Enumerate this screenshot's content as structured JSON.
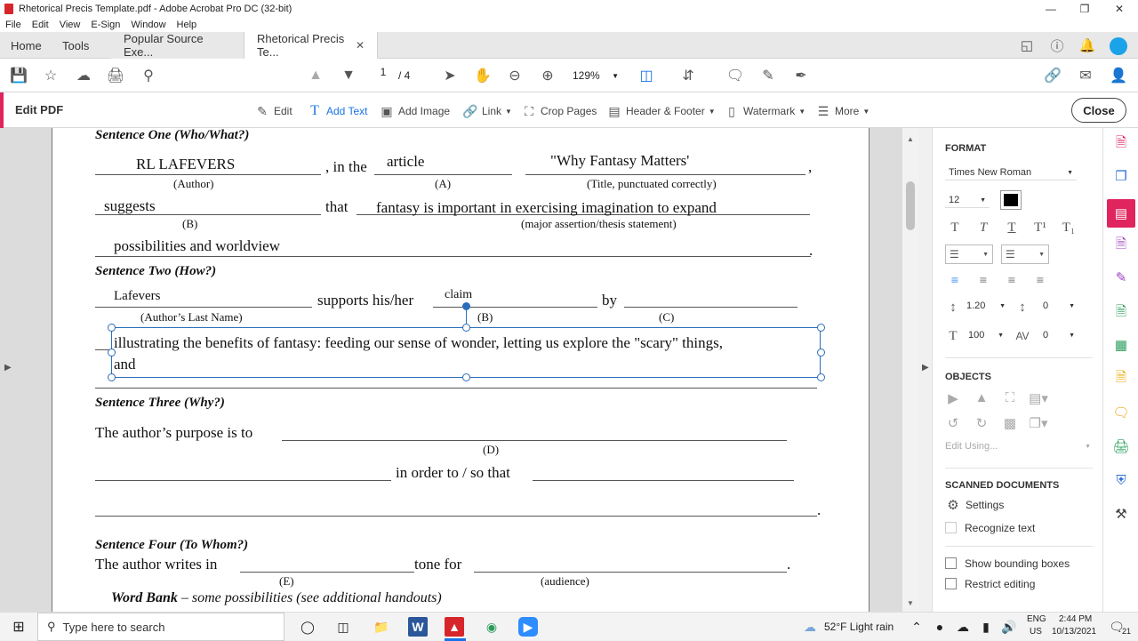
{
  "window": {
    "title": "Rhetorical Precis Template.pdf - Adobe Acrobat Pro DC (32-bit)"
  },
  "menu": [
    "File",
    "Edit",
    "View",
    "E-Sign",
    "Window",
    "Help"
  ],
  "tabs": {
    "home": "Home",
    "tools": "Tools",
    "doc1": "Popular Source Exe...",
    "doc2": "Rhetorical Precis Te..."
  },
  "toolbar": {
    "page_current": "1",
    "page_total": "/ 4",
    "zoom": "129%"
  },
  "editbar": {
    "label": "Edit PDF",
    "tools": [
      "Edit",
      "Add Text",
      "Add Image",
      "Link",
      "Crop Pages",
      "Header & Footer",
      "Watermark",
      "More"
    ],
    "close": "Close"
  },
  "doc": {
    "s1_header": "Sentence One (Who/What?)",
    "author_value": "RL LAFEVERS",
    "in_the": ", in the",
    "type_value": "article",
    "title_value": "\"Why Fantasy Matters'",
    "comma": ",",
    "lbl_author": "(Author)",
    "lbl_a": "(A)",
    "lbl_title": "(Title, punctuated correctly)",
    "verb_value": "suggests",
    "that": "that",
    "thesis_value": "fantasy is important in exercising imagination to expand",
    "lbl_b": "(B)",
    "lbl_thesis": "(major assertion/thesis statement)",
    "thesis_cont": "possibilities and worldview",
    "period": ".",
    "s2_header": "Sentence Two (How?)",
    "lastname_value": "Lafevers",
    "supports": "supports his/her",
    "claim_value": "claim",
    "by": "by",
    "lbl_lastname": "(Author’s Last Name)",
    "lbl_b2": "(B)",
    "lbl_c": "(C)",
    "textbox_line1": "illustrating the benefits of fantasy: feeding our sense of wonder, letting us explore the \"scary\" things,",
    "textbox_line2": "and",
    "s3_header": "Sentence Three (Why?)",
    "purpose": "The author’s purpose is to",
    "lbl_d": "(D)",
    "in_order": "in order to / so that",
    "period2": ".",
    "s4_header": "Sentence Four (To Whom?)",
    "writes_in": "The author writes in",
    "tone_for": "tone for",
    "period3": ".",
    "lbl_e": "(E)",
    "lbl_audience": "(audience)",
    "word_bank": "Word Bank",
    "word_bank_rest": " – some possibilities (see additional handouts)"
  },
  "format": {
    "header": "FORMAT",
    "font": "Times New Roman",
    "size": "12",
    "color": "#000000",
    "line_spacing": "1.20",
    "para_spacing": "0",
    "scale": "100",
    "char_spacing": "0",
    "objects_header": "OBJECTS",
    "edit_using": "Edit Using...",
    "scanned_header": "SCANNED DOCUMENTS",
    "settings": "Settings",
    "recognize": "Recognize text",
    "show_bounding": "Show bounding boxes",
    "restrict": "Restrict editing"
  },
  "taskbar": {
    "search_placeholder": "Type here to search",
    "weather": "52°F  Light rain",
    "lang1": "ENG",
    "lang2": "US",
    "time": "2:44 PM",
    "date": "10/13/2021",
    "notif": "21"
  },
  "icons": [
    "acrobat-icon",
    "save-icon",
    "star-icon",
    "upload-icon",
    "print-icon",
    "search-icon",
    "prev-page-icon",
    "next-page-icon",
    "select-icon",
    "hand-icon",
    "zoom-out-icon",
    "zoom-in-icon",
    "fit-icon",
    "scroll-icon",
    "comment-icon",
    "highlight-icon",
    "sign-icon",
    "link-share-icon",
    "mail-icon",
    "user-add-icon"
  ]
}
